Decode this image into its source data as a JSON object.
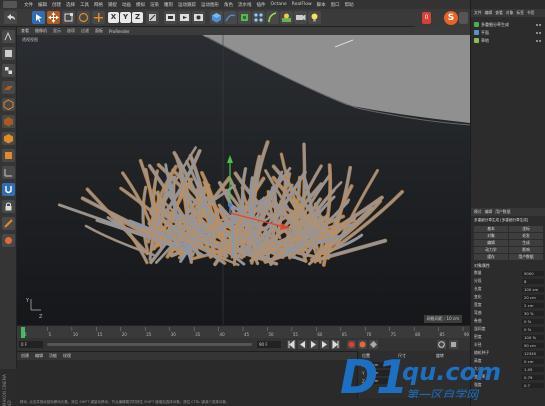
{
  "menubar": {
    "items": [
      "文件",
      "编辑",
      "创建",
      "选择",
      "工具",
      "网格",
      "捕捉",
      "动画",
      "模拟",
      "渲染",
      "雕刻",
      "运动跟踪",
      "运动图形",
      "角色",
      "流水线",
      "插件",
      "Octane",
      "RealFlow",
      "脚本",
      "窗口",
      "帮助"
    ]
  },
  "toolbar": {
    "axis_x": "X",
    "axis_y": "Y",
    "axis_z": "Z",
    "frame_badge_value": "0",
    "brand_badge": "S"
  },
  "viewport": {
    "menu": [
      "查看",
      "摄像机",
      "显示",
      "选项",
      "过滤",
      "面板",
      "ProRender"
    ],
    "label": "透视视图",
    "grid_info": "网格间距 : 10 cm",
    "axis_y_label": "Y",
    "axis_z_label": "Z"
  },
  "timeline": {
    "ticks": [
      "0",
      "5",
      "10",
      "15",
      "20",
      "25",
      "30",
      "35",
      "40",
      "45",
      "50",
      "55",
      "60",
      "65",
      "70",
      "75",
      "80",
      "85",
      "90"
    ],
    "start": "0 F",
    "end": "90 F",
    "current_frame": "0 F",
    "start_field": "0 F",
    "end_field": "90 F"
  },
  "material_manager": {
    "menu": [
      "创建",
      "编辑",
      "功能",
      "纹理"
    ]
  },
  "coords_panel": {
    "position_header": "位置",
    "size_header": "尺寸",
    "rotation_header": "旋转",
    "rows": [
      {
        "axis": "X",
        "value": "0 cm"
      },
      {
        "axis": "Y",
        "value": "0 cm"
      },
      {
        "axis": "Z",
        "value": "0 cm"
      }
    ]
  },
  "object_manager": {
    "menu": [
      "文件",
      "编辑",
      "查看",
      "对象",
      "标签",
      "书签"
    ],
    "objects": [
      {
        "name": "多重细分草生成",
        "color": "#4cae4c"
      },
      {
        "name": "平面",
        "color": "#5a8fd0"
      },
      {
        "name": "草地",
        "color": "#8fbf4a"
      }
    ]
  },
  "attribute_manager": {
    "menu": [
      "模式",
      "编辑",
      "用户数据"
    ],
    "object_title": "多重细分草生成 [多重细分草生成]",
    "tabs": [
      "基本",
      "坐标",
      "对象",
      "毛发",
      "编辑",
      "生成",
      "动力学",
      "影响",
      "缓存",
      "用户数据"
    ],
    "section": "对象属性",
    "fields": [
      {
        "label": "数量",
        "value": "5000"
      },
      {
        "label": "分段",
        "value": "8"
      },
      {
        "label": "长度",
        "value": "100 cm"
      },
      {
        "label": "变化",
        "value": "20 cm"
      },
      {
        "label": "宽度",
        "value": "2 cm"
      },
      {
        "label": "弯曲",
        "value": "30 %"
      },
      {
        "label": "卷曲",
        "value": "0 %"
      },
      {
        "label": "湿润度",
        "value": "0 %"
      },
      {
        "label": "密度",
        "value": "100 %"
      },
      {
        "label": "半径",
        "value": "50 cm"
      },
      {
        "label": "随机种子",
        "value": "12345"
      },
      {
        "label": "高度",
        "value": "0 cm"
      },
      {
        "label": "大小",
        "value": "1.05"
      },
      {
        "label": "变化率",
        "value": "0.79"
      },
      {
        "label": "强度",
        "value": "0.7"
      }
    ]
  },
  "watermark": {
    "big": "D1",
    "small": "qu.com",
    "cn": "第一区自学网"
  },
  "status": {
    "text": "移动: 点击并拖动鼠标移动元素。按住 SHIFT 键量化移动；节点编辑模式时按住 SHIFT 键增加选择对象；按住 CTRL 键减少选择对象。",
    "side_label": "MAXON CINEMA 4D"
  },
  "colors": {
    "grass_blade": "#8c96a6",
    "grass_outline": "#e08a2c",
    "accent_orange": "#e8622a",
    "watermark_blue": "#1d6fc2"
  }
}
